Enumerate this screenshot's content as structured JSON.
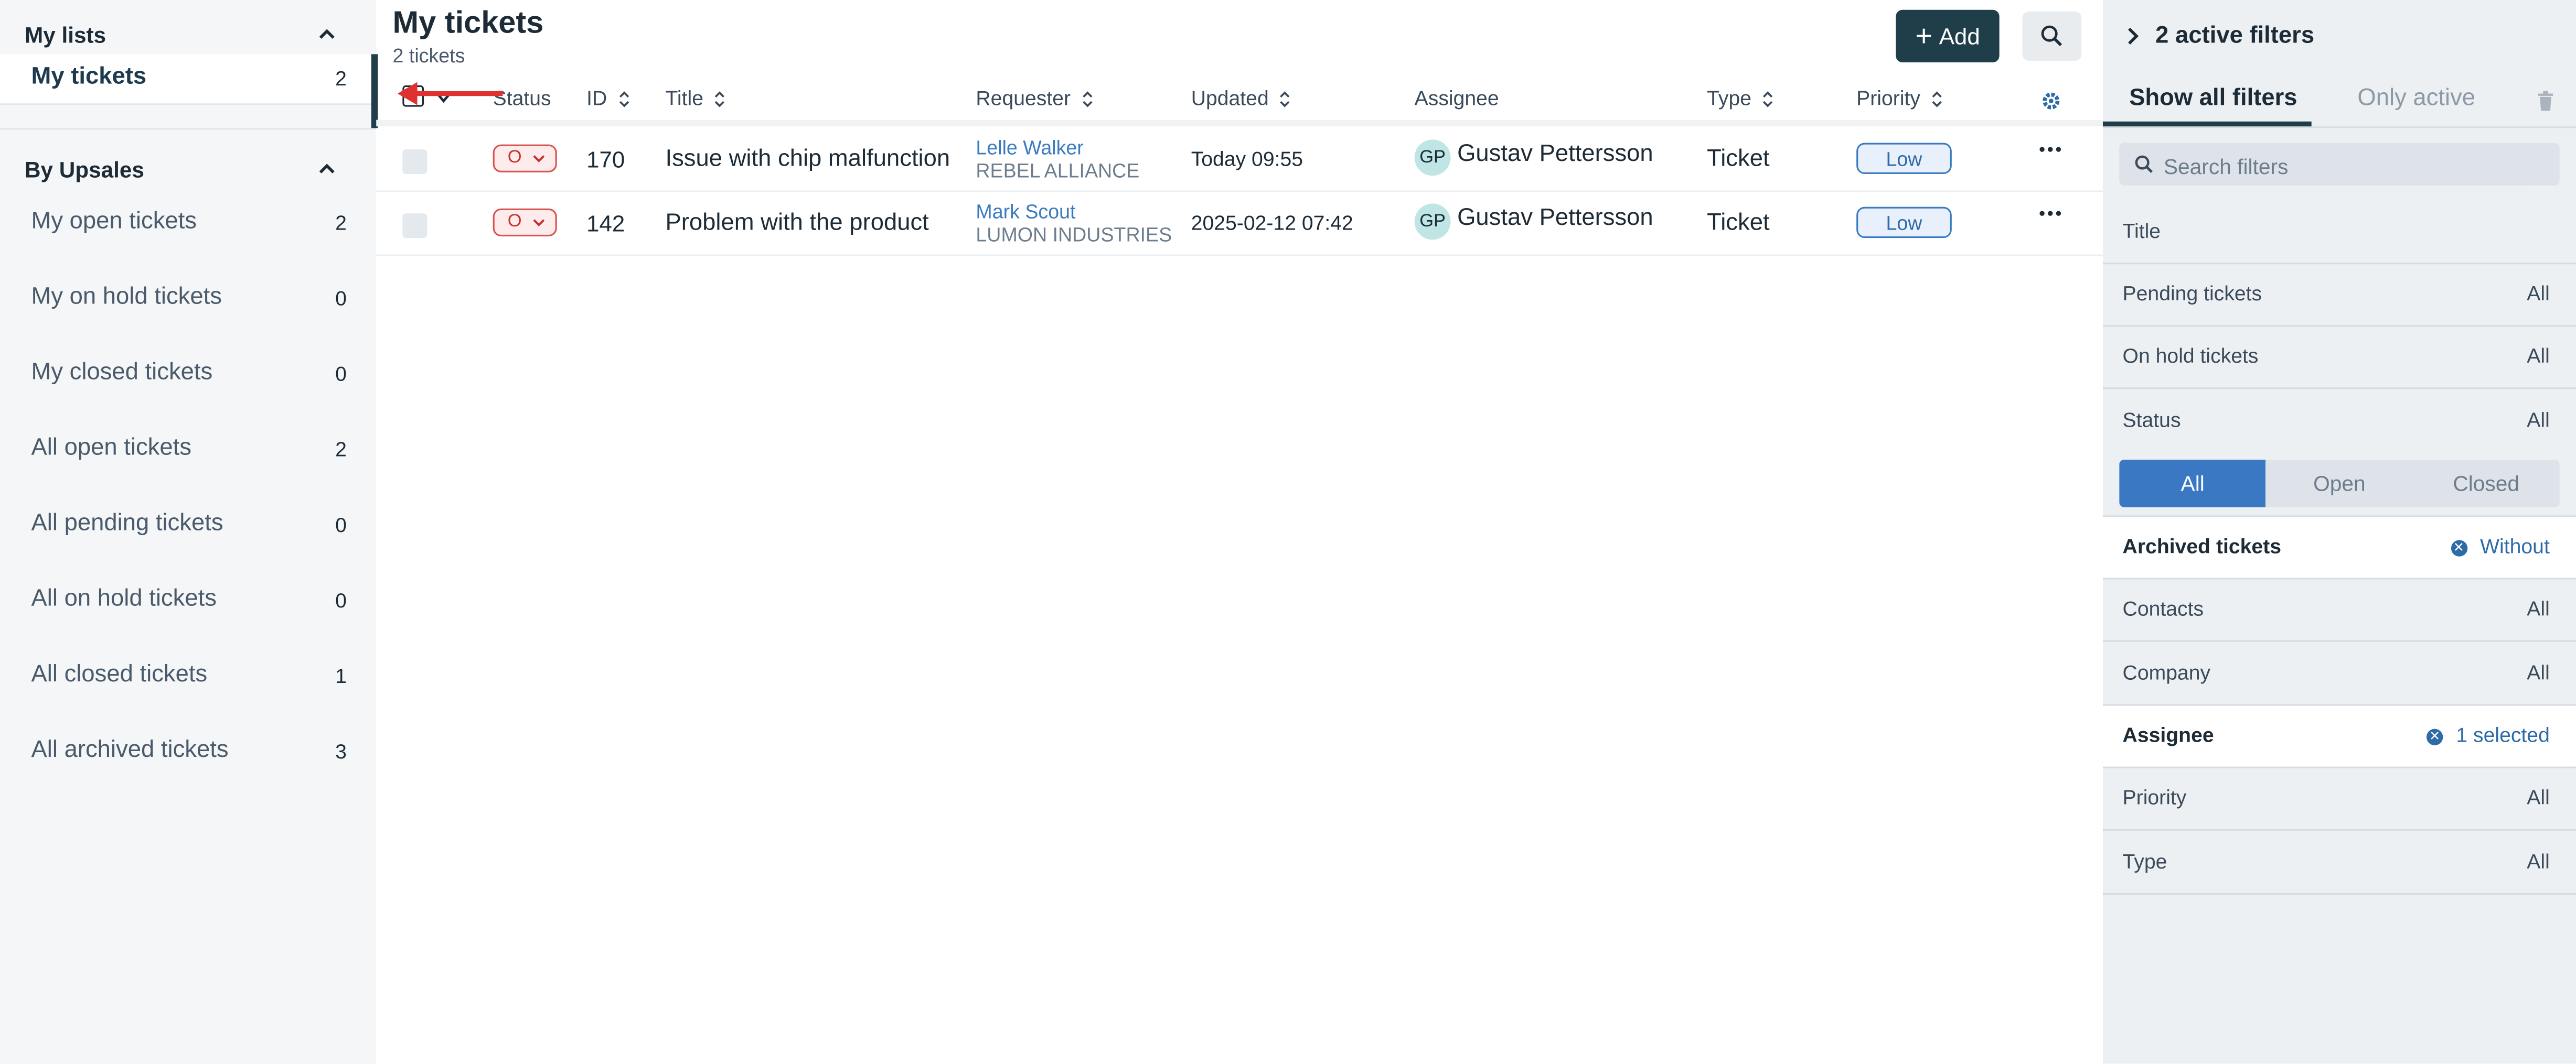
{
  "sidebar": {
    "my_lists": {
      "title": "My lists",
      "items": [
        {
          "label": "My tickets",
          "count": "2"
        }
      ]
    },
    "by_upsales": {
      "title": "By Upsales",
      "items": [
        {
          "label": "My open tickets",
          "count": "2"
        },
        {
          "label": "My on hold tickets",
          "count": "0"
        },
        {
          "label": "My closed tickets",
          "count": "0"
        },
        {
          "label": "All open tickets",
          "count": "2"
        },
        {
          "label": "All pending tickets",
          "count": "0"
        },
        {
          "label": "All on hold tickets",
          "count": "0"
        },
        {
          "label": "All closed tickets",
          "count": "1"
        },
        {
          "label": "All archived tickets",
          "count": "3"
        }
      ]
    }
  },
  "main": {
    "title": "My tickets",
    "count_text": "2 tickets",
    "add_label": "Add",
    "columns": {
      "status": "Status",
      "id": "ID",
      "title": "Title",
      "requester": "Requester",
      "updated": "Updated",
      "assignee": "Assignee",
      "type": "Type",
      "priority": "Priority"
    },
    "rows": [
      {
        "status": "O",
        "id": "170",
        "title": "Issue with chip malfunction",
        "requester_name": "Lelle Walker",
        "requester_company": "REBEL ALLIANCE",
        "updated": "Today 09:55",
        "assignee_initials": "GP",
        "assignee": "Gustav Pettersson",
        "type": "Ticket",
        "priority": "Low"
      },
      {
        "status": "O",
        "id": "142",
        "title": "Problem with the product",
        "requester_name": "Mark Scout",
        "requester_company": "LUMON INDUSTRIES",
        "updated": "2025-02-12 07:42",
        "assignee_initials": "GP",
        "assignee": "Gustav Pettersson",
        "type": "Ticket",
        "priority": "Low"
      }
    ]
  },
  "filters": {
    "header": "2 active filters",
    "tabs": {
      "all": "Show all filters",
      "active": "Only active"
    },
    "search_placeholder": "Search filters",
    "title_row": "Title",
    "pending": {
      "label": "Pending tickets",
      "value": "All"
    },
    "onhold": {
      "label": "On hold tickets",
      "value": "All"
    },
    "status": {
      "label": "Status",
      "value": "All",
      "options": [
        "All",
        "Open",
        "Closed"
      ],
      "selected": "All"
    },
    "archived": {
      "label": "Archived tickets",
      "value": "Without"
    },
    "contacts": {
      "label": "Contacts",
      "value": "All"
    },
    "company": {
      "label": "Company",
      "value": "All"
    },
    "assignee": {
      "label": "Assignee",
      "value": "1 selected"
    },
    "priority": {
      "label": "Priority",
      "value": "All"
    },
    "type": {
      "label": "Type",
      "value": "All"
    }
  },
  "colors": {
    "accent_dark": "#1f3e4a",
    "status_open_red": "#d9534f",
    "priority_blue": "#3a7bbf",
    "segment_selected": "#3b78c3",
    "annotation_arrow": "#e03131"
  }
}
